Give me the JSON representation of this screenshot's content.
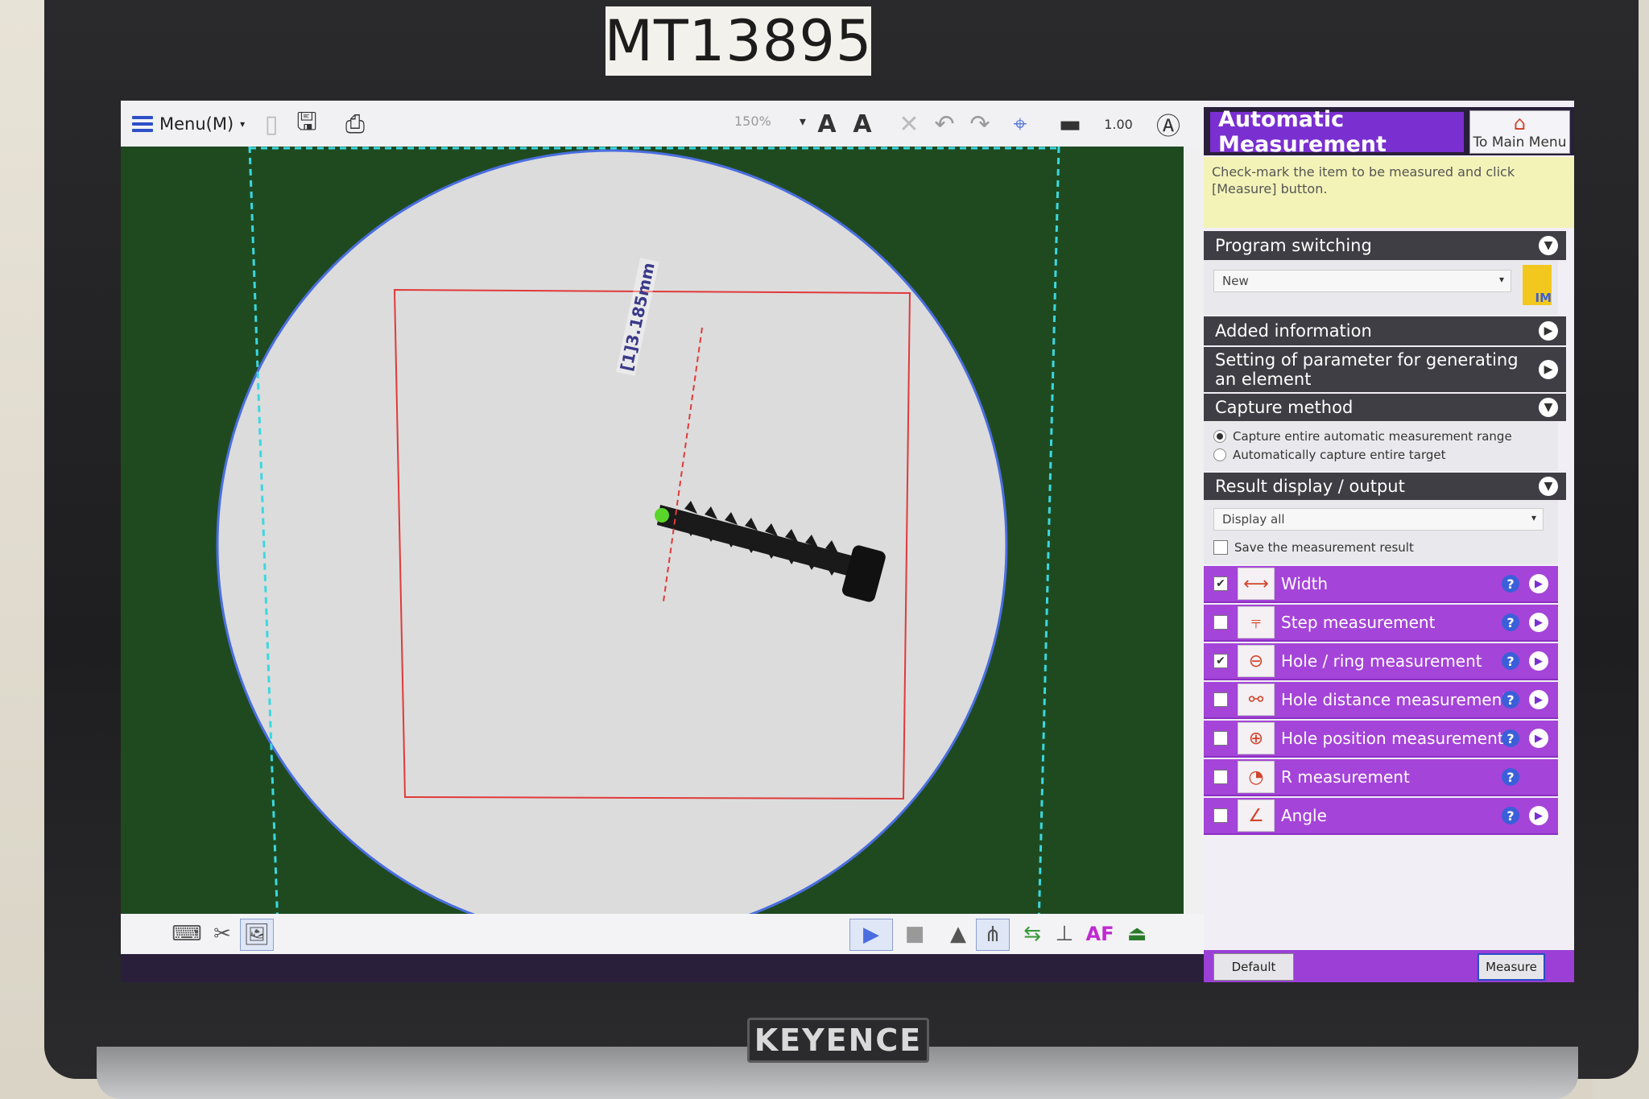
{
  "asset_tag": "MT13895",
  "brand": "KEYENCE",
  "toolbar": {
    "menu_label": "Menu(M)",
    "zoom": "150%"
  },
  "view": {
    "measurement_label": "[1]3.185mm"
  },
  "panel": {
    "title": "Automatic Measurement",
    "main_menu_label": "To Main Menu",
    "instructions": "Check-mark the item to be measured and click [Measure] button.",
    "program_switching": {
      "header": "Program switching",
      "selected": "New",
      "file_badge": "IM"
    },
    "added_information": "Added information",
    "parameter_setting": "Setting of parameter for generating an element",
    "capture_method": {
      "header": "Capture method",
      "options": [
        {
          "label": "Capture entire automatic measurement range",
          "selected": true
        },
        {
          "label": "Automatically capture entire target",
          "selected": false
        }
      ]
    },
    "result_display": {
      "header": "Result display / output",
      "selected": "Display all",
      "save_label": "Save the measurement result",
      "save_checked": false
    },
    "items": [
      {
        "label": "Width",
        "checked": true,
        "icon": "width-icon",
        "has_go": true
      },
      {
        "label": "Step measurement",
        "checked": false,
        "icon": "step-icon",
        "has_go": true
      },
      {
        "label": "Hole / ring measurement",
        "checked": true,
        "icon": "hole-ring-icon",
        "has_go": true
      },
      {
        "label": "Hole distance measurement",
        "checked": false,
        "icon": "hole-distance-icon",
        "has_go": true
      },
      {
        "label": "Hole position measurement",
        "checked": false,
        "icon": "hole-position-icon",
        "has_go": true
      },
      {
        "label": "R measurement",
        "checked": false,
        "icon": "radius-icon",
        "has_go": false
      },
      {
        "label": "Angle",
        "checked": false,
        "icon": "angle-icon",
        "has_go": true
      }
    ],
    "footer": {
      "default_label": "Default",
      "measure_label": "Measure"
    }
  },
  "statusbar": {
    "af_label": "AF"
  },
  "colors": {
    "accent": "#7a2fd0",
    "item_bg": "#a544d8",
    "stage_bg": "#1f4a20",
    "roi": "#e03a3a",
    "range": "#3ad8e0"
  }
}
